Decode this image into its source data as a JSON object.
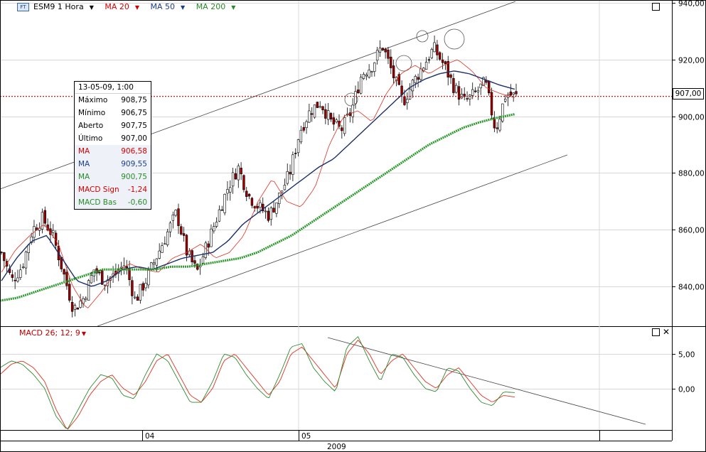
{
  "toolbar": {
    "symbol_icon": "FT",
    "symbol": "ESM9 1 Hora",
    "ma20": "MA 20",
    "ma50": "MA 50",
    "ma200": "MA 200"
  },
  "macd_label": "MACD 26; 12; 9",
  "current_price_tag": "907,00",
  "info_box": {
    "date": "13-05-09, 1:00",
    "rows": [
      {
        "label": "Máximo",
        "value": "908,75",
        "color": "#000000"
      },
      {
        "label": "Mínimo",
        "value": "906,75",
        "color": "#000000"
      },
      {
        "label": "Aberto",
        "value": "907,75",
        "color": "#000000"
      },
      {
        "label": "Último",
        "value": "907,00",
        "color": "#000000"
      },
      {
        "label": "MA",
        "value": "906,58",
        "color": "#d40000"
      },
      {
        "label": "MA",
        "value": "909,55",
        "color": "#1b3f8a"
      },
      {
        "label": "MA",
        "value": "900,75",
        "color": "#2a8a2a"
      },
      {
        "label": "MACD Sign",
        "value": "-1,24",
        "color": "#d40000"
      },
      {
        "label": "MACD Bas",
        "value": "-0,60",
        "color": "#2a8a2a"
      }
    ]
  },
  "colors": {
    "ma20": "#e03020",
    "ma50": "#1b2f6b",
    "ma200": "#2f9a2f",
    "up_candle": "#ffffff",
    "down_candle": "#a00000",
    "price_line": "#c00000",
    "macd_signal": "#e03020",
    "macd_base": "#2f8a2f"
  },
  "chart_data": [
    {
      "type": "candlestick",
      "title": "ESM9 1 Hora",
      "y_ticks": [
        "840,00",
        "860,00",
        "880,00",
        "900,00",
        "920,00",
        "940,00"
      ],
      "y_tick_values": [
        840,
        860,
        880,
        900,
        920,
        940
      ],
      "ylim": [
        826,
        941
      ],
      "x_ticks": [
        "04",
        "05"
      ],
      "x_year": "2009",
      "current_price": 907.0,
      "series": [
        {
          "name": "MA 20",
          "values_sampled": [
            845,
            853,
            858,
            862,
            855,
            840,
            832,
            838,
            845,
            848,
            846,
            845,
            850,
            852,
            855,
            850,
            852,
            858,
            870,
            878,
            870,
            868,
            875,
            890,
            900,
            902,
            898,
            908,
            915,
            918,
            915,
            918,
            920,
            916,
            910,
            908,
            906.58
          ]
        },
        {
          "name": "MA 50",
          "values_sampled": [
            842,
            850,
            856,
            858,
            850,
            842,
            840,
            842,
            846,
            847,
            846,
            848,
            850,
            851,
            852,
            856,
            862,
            866,
            870,
            874,
            878,
            882,
            885,
            890,
            895,
            900,
            905,
            910,
            913,
            915,
            916,
            915,
            913,
            911,
            909.55
          ]
        },
        {
          "name": "MA 200",
          "values_sampled": [
            835,
            836,
            838,
            840,
            842,
            844,
            846,
            846,
            846,
            846,
            847,
            847,
            848,
            849,
            850,
            852,
            855,
            858,
            862,
            866,
            870,
            874,
            878,
            882,
            886,
            890,
            893,
            896,
            898,
            899.5,
            900.75
          ]
        }
      ],
      "ohlc_close_sampled": [
        852,
        842,
        847,
        860,
        864,
        858,
        845,
        832,
        836,
        846,
        842,
        844,
        848,
        835,
        842,
        850,
        858,
        866,
        852,
        845,
        855,
        865,
        875,
        882,
        872,
        868,
        865,
        872,
        880,
        895,
        902,
        905,
        898,
        895,
        902,
        915,
        918,
        925,
        915,
        905,
        912,
        918,
        924,
        918,
        910,
        905,
        908,
        912,
        895,
        908,
        907
      ]
    },
    {
      "type": "line",
      "title": "MACD 26; 12; 9",
      "y_ticks": [
        "0,00",
        "5,00"
      ],
      "y_tick_values": [
        0,
        5
      ],
      "ylim": [
        -6,
        9
      ],
      "series": [
        {
          "name": "MACD Sign",
          "values_sampled": [
            2,
            3.5,
            4,
            3,
            1,
            -3,
            -6,
            -4,
            -1,
            1,
            2,
            0,
            -1,
            1,
            4,
            5,
            2,
            -1,
            -2,
            0,
            4,
            5,
            3,
            1,
            -1,
            1,
            5,
            6,
            4,
            2,
            0,
            5,
            7,
            5,
            2,
            4,
            5,
            3,
            1,
            0,
            2,
            3,
            1,
            -1,
            -2,
            -1,
            -1.24
          ]
        },
        {
          "name": "MACD Bas",
          "values_sampled": [
            3,
            4,
            3.5,
            2,
            0,
            -4,
            -6,
            -3,
            0,
            2,
            1.5,
            -1,
            -1.5,
            2,
            5,
            4,
            1,
            -2,
            -2,
            1,
            5,
            4.5,
            2,
            0,
            -1.5,
            2,
            6,
            6.5,
            3,
            1,
            -0.5,
            6,
            7.5,
            4,
            1,
            5,
            4.5,
            2,
            0,
            -0.5,
            3,
            2.5,
            0,
            -2,
            -2.5,
            -0.5,
            -0.6
          ]
        }
      ]
    }
  ]
}
